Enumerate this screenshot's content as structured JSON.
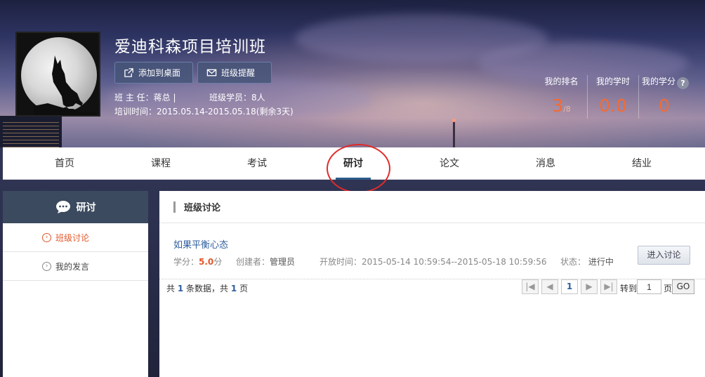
{
  "header": {
    "class_title": "爱迪科森项目培训班",
    "buttons": {
      "add_to_desktop": "添加到桌面",
      "class_reminder": "班级提醒"
    },
    "teacher_label": "班 主 任：",
    "teacher_value": "蒋总 |",
    "students_label": "班级学员：",
    "students_value": "8人",
    "training_time": "培训时间：2015.05.14-2015.05.18(剩余3天)",
    "stats": [
      {
        "label": "我的排名",
        "value": "3",
        "suffix": "/8"
      },
      {
        "label": "我的学时",
        "value": "0.0",
        "suffix": ""
      },
      {
        "label": "我的学分",
        "value": "0",
        "suffix": ""
      }
    ],
    "help_glyph": "?",
    "accent_color": "#f36b32"
  },
  "nav": {
    "items": [
      {
        "label": "首页"
      },
      {
        "label": "课程"
      },
      {
        "label": "考试"
      },
      {
        "label": "研讨",
        "active": true
      },
      {
        "label": "论文"
      },
      {
        "label": "消息"
      },
      {
        "label": "结业"
      }
    ]
  },
  "sidebar": {
    "title": "研讨",
    "title_icon": "chat-bubble-icon",
    "items": [
      {
        "label": "班级讨论",
        "active": true,
        "icon": "chevron-circle-icon"
      },
      {
        "label": "我的发言",
        "active": false,
        "icon": "chevron-circle-icon"
      }
    ]
  },
  "main": {
    "panel_title": "班级讨论",
    "discussion": {
      "title": "如果平衡心态",
      "credit_label": "学分：",
      "credit_value": "5.0",
      "credit_unit": "分",
      "creator_label": "创建者：",
      "creator_value": "管理员",
      "open_time": "开放时间：2015-05-14 10:59:54--2015-05-18 10:59:56",
      "status_label": "状态：",
      "status_value": "进行中",
      "enter_label": "进入讨论"
    },
    "pager": {
      "prefix": "共",
      "total_records": "1",
      "records_unit": "条数据，共",
      "total_pages": "1",
      "pages_unit": "页",
      "first": "|◀",
      "prev": "◀",
      "current": "1",
      "next": "▶",
      "last": "▶|",
      "goto_label": "转到",
      "goto_value": "1",
      "page_label": "页",
      "go_label": "GO"
    }
  }
}
